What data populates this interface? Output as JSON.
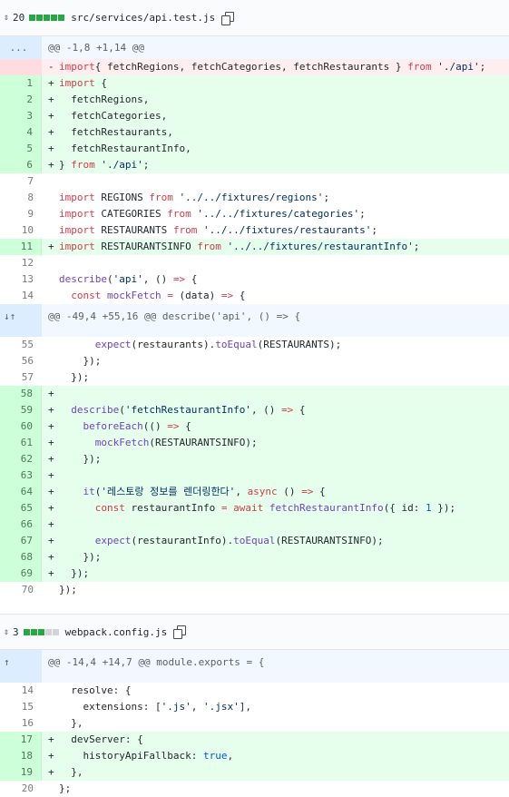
{
  "files": [
    {
      "change_count": "20",
      "diffstat": [
        "add",
        "add",
        "add",
        "add",
        "add"
      ],
      "path": "src/services/api.test.js",
      "copy_icon": "copy-icon"
    },
    {
      "change_count": "3",
      "diffstat": [
        "add",
        "add",
        "add",
        "neutral",
        "neutral"
      ],
      "path": "webpack.config.js",
      "copy_icon": "copy-icon"
    }
  ],
  "hunks": [
    {
      "header": "@@ -1,8 +1,14 @@",
      "expander": "...",
      "lines": [
        {
          "type": "del",
          "num": "",
          "marker": "-",
          "tokens": [
            [
              "kw",
              "import"
            ],
            [
              "",
              "{ fetchRegions, fetchCategories, fetchRestaurants } "
            ],
            [
              "kw",
              "from"
            ],
            [
              "",
              " "
            ],
            [
              "str",
              "'./api'"
            ],
            [
              "",
              ";"
            ]
          ]
        },
        {
          "type": "add",
          "num": "1",
          "marker": "+",
          "tokens": [
            [
              "kw",
              "import"
            ],
            [
              "",
              " {"
            ]
          ]
        },
        {
          "type": "add",
          "num": "2",
          "marker": "+",
          "tokens": [
            [
              "",
              "  fetchRegions,"
            ]
          ]
        },
        {
          "type": "add",
          "num": "3",
          "marker": "+",
          "tokens": [
            [
              "",
              "  fetchCategories,"
            ]
          ]
        },
        {
          "type": "add",
          "num": "4",
          "marker": "+",
          "tokens": [
            [
              "",
              "  fetchRestaurants,"
            ]
          ]
        },
        {
          "type": "add",
          "num": "5",
          "marker": "+",
          "tokens": [
            [
              "",
              "  fetchRestaurantInfo,"
            ]
          ]
        },
        {
          "type": "add",
          "num": "6",
          "marker": "+",
          "tokens": [
            [
              "",
              "} "
            ],
            [
              "kw",
              "from"
            ],
            [
              "",
              " "
            ],
            [
              "str",
              "'./api'"
            ],
            [
              "",
              ";"
            ]
          ]
        },
        {
          "type": "context",
          "num": "7",
          "marker": "",
          "tokens": []
        },
        {
          "type": "context",
          "num": "8",
          "marker": "",
          "tokens": [
            [
              "kw",
              "import"
            ],
            [
              "",
              " REGIONS "
            ],
            [
              "kw",
              "from"
            ],
            [
              "",
              " "
            ],
            [
              "str",
              "'../../fixtures/regions'"
            ],
            [
              "",
              ";"
            ]
          ]
        },
        {
          "type": "context",
          "num": "9",
          "marker": "",
          "tokens": [
            [
              "kw",
              "import"
            ],
            [
              "",
              " CATEGORIES "
            ],
            [
              "kw",
              "from"
            ],
            [
              "",
              " "
            ],
            [
              "str",
              "'../../fixtures/categories'"
            ],
            [
              "",
              ";"
            ]
          ]
        },
        {
          "type": "context",
          "num": "10",
          "marker": "",
          "tokens": [
            [
              "kw",
              "import"
            ],
            [
              "",
              " RESTAURANTS "
            ],
            [
              "kw",
              "from"
            ],
            [
              "",
              " "
            ],
            [
              "str",
              "'../../fixtures/restaurants'"
            ],
            [
              "",
              ";"
            ]
          ]
        },
        {
          "type": "add",
          "num": "11",
          "marker": "+",
          "tokens": [
            [
              "kw",
              "import"
            ],
            [
              "",
              " RESTAURANTSINFO "
            ],
            [
              "kw",
              "from"
            ],
            [
              "",
              " "
            ],
            [
              "str",
              "'../../fixtures/restaurantInfo'"
            ],
            [
              "",
              ";"
            ]
          ]
        },
        {
          "type": "context",
          "num": "12",
          "marker": "",
          "tokens": []
        },
        {
          "type": "context",
          "num": "13",
          "marker": "",
          "tokens": [
            [
              "fn",
              "describe"
            ],
            [
              "",
              "("
            ],
            [
              "str",
              "'api'"
            ],
            [
              "",
              ", () "
            ],
            [
              "kw",
              "=>"
            ],
            [
              "",
              " {"
            ]
          ]
        },
        {
          "type": "context",
          "num": "14",
          "marker": "",
          "tokens": [
            [
              "",
              "  "
            ],
            [
              "kw",
              "const"
            ],
            [
              "",
              " "
            ],
            [
              "fn",
              "mockFetch"
            ],
            [
              "",
              " "
            ],
            [
              "kw",
              "="
            ],
            [
              "",
              " (data) "
            ],
            [
              "kw",
              "=>"
            ],
            [
              "",
              " {"
            ]
          ]
        }
      ]
    },
    {
      "header": "@@ -49,4 +55,16 @@ describe('api', () => {",
      "expander": "↓↑",
      "lines": [
        {
          "type": "context",
          "num": "55",
          "marker": "",
          "tokens": [
            [
              "",
              "      "
            ],
            [
              "fn",
              "expect"
            ],
            [
              "",
              "(restaurants)."
            ],
            [
              "fn",
              "toEqual"
            ],
            [
              "",
              "(RESTAURANTS);"
            ]
          ]
        },
        {
          "type": "context",
          "num": "56",
          "marker": "",
          "tokens": [
            [
              "",
              "    });"
            ]
          ]
        },
        {
          "type": "context",
          "num": "57",
          "marker": "",
          "tokens": [
            [
              "",
              "  });"
            ]
          ]
        },
        {
          "type": "add",
          "num": "58",
          "marker": "+",
          "tokens": []
        },
        {
          "type": "add",
          "num": "59",
          "marker": "+",
          "tokens": [
            [
              "",
              "  "
            ],
            [
              "fn",
              "describe"
            ],
            [
              "",
              "("
            ],
            [
              "str",
              "'fetchRestaurantInfo'"
            ],
            [
              "",
              ", () "
            ],
            [
              "kw",
              "=>"
            ],
            [
              "",
              " {"
            ]
          ]
        },
        {
          "type": "add",
          "num": "60",
          "marker": "+",
          "tokens": [
            [
              "",
              "    "
            ],
            [
              "fn",
              "beforeEach"
            ],
            [
              "",
              "(() "
            ],
            [
              "kw",
              "=>"
            ],
            [
              "",
              " {"
            ]
          ]
        },
        {
          "type": "add",
          "num": "61",
          "marker": "+",
          "tokens": [
            [
              "",
              "      "
            ],
            [
              "fn",
              "mockFetch"
            ],
            [
              "",
              "(RESTAURANTSINFO);"
            ]
          ]
        },
        {
          "type": "add",
          "num": "62",
          "marker": "+",
          "tokens": [
            [
              "",
              "    });"
            ]
          ]
        },
        {
          "type": "add",
          "num": "63",
          "marker": "+",
          "tokens": []
        },
        {
          "type": "add",
          "num": "64",
          "marker": "+",
          "tokens": [
            [
              "",
              "    "
            ],
            [
              "fn",
              "it"
            ],
            [
              "",
              "("
            ],
            [
              "str",
              "'레스토랑 정보를 렌더링한다'"
            ],
            [
              "",
              ", "
            ],
            [
              "kw",
              "async"
            ],
            [
              "",
              " () "
            ],
            [
              "kw",
              "=>"
            ],
            [
              "",
              " {"
            ]
          ]
        },
        {
          "type": "add",
          "num": "65",
          "marker": "+",
          "tokens": [
            [
              "",
              "      "
            ],
            [
              "kw",
              "const"
            ],
            [
              "",
              " restaurantInfo "
            ],
            [
              "kw",
              "="
            ],
            [
              "",
              " "
            ],
            [
              "kw",
              "await"
            ],
            [
              "",
              " "
            ],
            [
              "fn",
              "fetchRestaurantInfo"
            ],
            [
              "",
              "({ id: "
            ],
            [
              "const",
              "1"
            ],
            [
              "",
              " });"
            ]
          ]
        },
        {
          "type": "add",
          "num": "66",
          "marker": "+",
          "tokens": []
        },
        {
          "type": "add",
          "num": "67",
          "marker": "+",
          "tokens": [
            [
              "",
              "      "
            ],
            [
              "fn",
              "expect"
            ],
            [
              "",
              "(restaurantInfo)."
            ],
            [
              "fn",
              "toEqual"
            ],
            [
              "",
              "(RESTAURANTSINFO);"
            ]
          ]
        },
        {
          "type": "add",
          "num": "68",
          "marker": "+",
          "tokens": [
            [
              "",
              "    });"
            ]
          ]
        },
        {
          "type": "add",
          "num": "69",
          "marker": "+",
          "tokens": [
            [
              "",
              "  });"
            ]
          ]
        },
        {
          "type": "context",
          "num": "70",
          "marker": "",
          "tokens": [
            [
              "",
              "});"
            ]
          ]
        }
      ]
    },
    {
      "header": "@@ -14,4 +14,7 @@ module.exports = {",
      "expander": "↑",
      "lines": [
        {
          "type": "context",
          "num": "14",
          "marker": "",
          "tokens": [
            [
              "",
              "  resolve: {"
            ]
          ]
        },
        {
          "type": "context",
          "num": "15",
          "marker": "",
          "tokens": [
            [
              "",
              "    extensions: ["
            ],
            [
              "str",
              "'.js'"
            ],
            [
              "",
              ", "
            ],
            [
              "str",
              "'.jsx'"
            ],
            [
              "",
              "],"
            ]
          ]
        },
        {
          "type": "context",
          "num": "16",
          "marker": "",
          "tokens": [
            [
              "",
              "  },"
            ]
          ]
        },
        {
          "type": "add",
          "num": "17",
          "marker": "+",
          "tokens": [
            [
              "",
              "  devServer: {"
            ]
          ]
        },
        {
          "type": "add",
          "num": "18",
          "marker": "+",
          "tokens": [
            [
              "",
              "    historyApiFallback: "
            ],
            [
              "const",
              "true"
            ],
            [
              "",
              ","
            ]
          ]
        },
        {
          "type": "add",
          "num": "19",
          "marker": "+",
          "tokens": [
            [
              "",
              "  },"
            ]
          ]
        },
        {
          "type": "context",
          "num": "20",
          "marker": "",
          "tokens": [
            [
              "",
              "};"
            ]
          ]
        }
      ]
    }
  ]
}
